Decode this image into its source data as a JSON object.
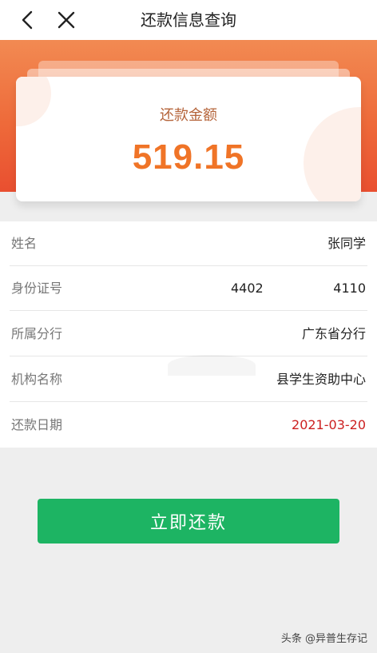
{
  "header": {
    "title": "还款信息查询",
    "back_icon": "back-arrow-icon",
    "close_icon": "close-icon"
  },
  "amount_card": {
    "label": "还款金额",
    "value": "519.15",
    "value_color": "#f07427"
  },
  "info": {
    "rows": [
      {
        "label": "姓名",
        "value": "张同学"
      },
      {
        "label": "身份证号",
        "value_part1": "4402",
        "value_part2": "4110"
      },
      {
        "label": "所属分行",
        "value": "广东省分行"
      },
      {
        "label": "机构名称",
        "value": "县学生资助中心"
      },
      {
        "label": "还款日期",
        "value": "2021-03-20",
        "value_color": "#cc1f1f"
      }
    ]
  },
  "actions": {
    "pay_label": "立即还款",
    "pay_color": "#1db463"
  },
  "watermark": {
    "source": "头条",
    "author": "@异普生存记"
  },
  "colors": {
    "banner": "#ee6a3a",
    "background": "#eeeeee"
  }
}
